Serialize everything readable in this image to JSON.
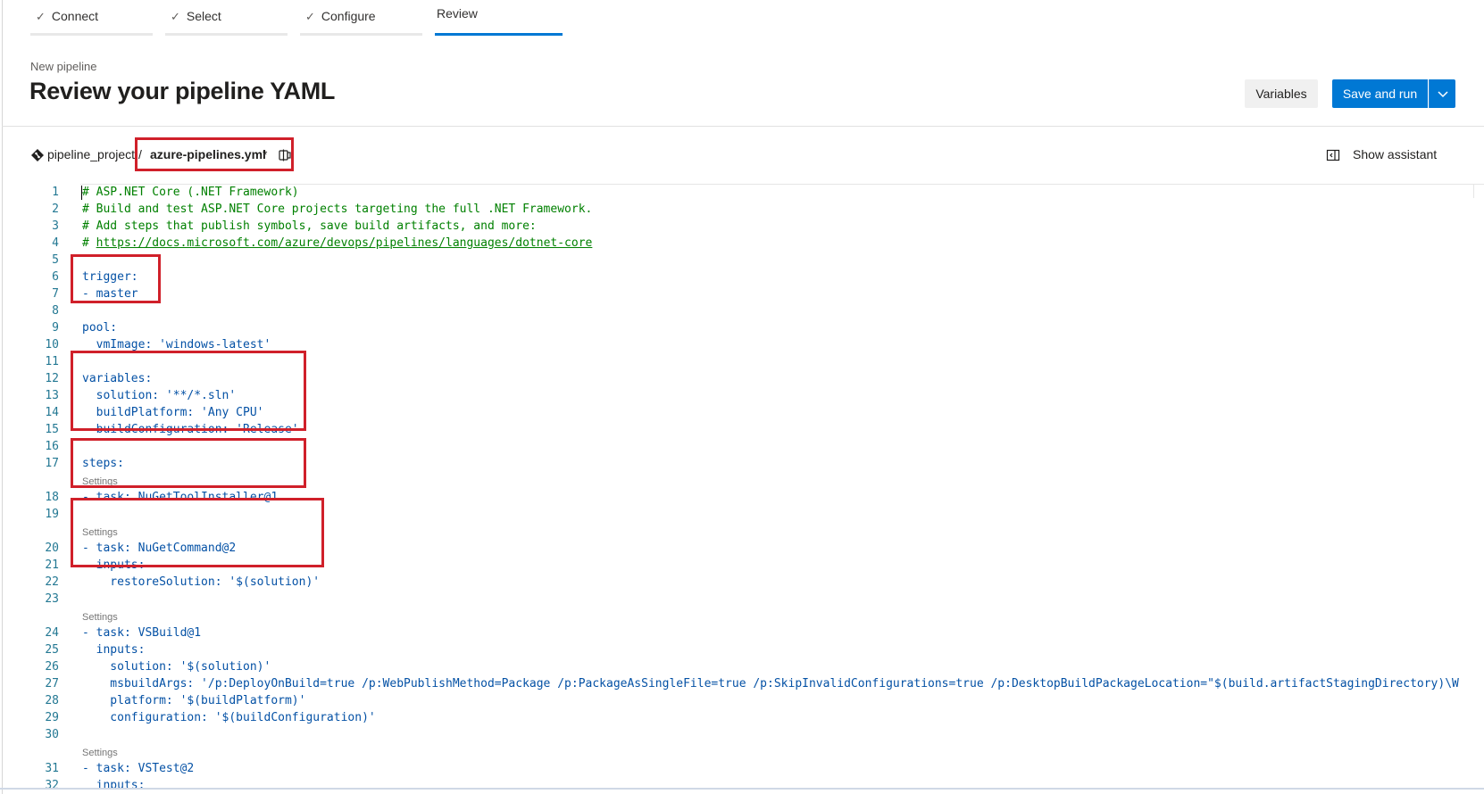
{
  "wizard": {
    "steps": [
      {
        "label": "Connect",
        "done": true
      },
      {
        "label": "Select",
        "done": true
      },
      {
        "label": "Configure",
        "done": true
      },
      {
        "label": "Review",
        "done": false,
        "active": true
      }
    ],
    "check_glyph": "✓"
  },
  "header": {
    "subtitle": "New pipeline",
    "title": "Review your pipeline YAML",
    "variables_button": "Variables",
    "save_run_button": "Save and run"
  },
  "breadcrumb": {
    "repo": "pipeline_project",
    "separator": "/",
    "file": "azure-pipelines.yml",
    "modified_marker": "*"
  },
  "assistant": {
    "label": "Show assistant"
  },
  "editor": {
    "lens_label": "Settings",
    "lines": [
      {
        "n": "1",
        "text": "# ASP.NET Core (.NET Framework)",
        "kind": "comment"
      },
      {
        "n": "2",
        "text": "# Build and test ASP.NET Core projects targeting the full .NET Framework.",
        "kind": "comment"
      },
      {
        "n": "3",
        "text": "# Add steps that publish symbols, save build artifacts, and more:",
        "kind": "comment"
      },
      {
        "n": "4",
        "text": "https://docs.microsoft.com/azure/devops/pipelines/languages/dotnet-core",
        "kind": "link"
      },
      {
        "n": "5",
        "text": "",
        "kind": "plain"
      },
      {
        "n": "6",
        "text": "trigger:",
        "kind": "plain"
      },
      {
        "n": "7",
        "text": "- master",
        "kind": "plain"
      },
      {
        "n": "8",
        "text": "",
        "kind": "plain"
      },
      {
        "n": "9",
        "text": "pool:",
        "kind": "plain"
      },
      {
        "n": "10",
        "text": "  vmImage: 'windows-latest'",
        "kind": "plain"
      },
      {
        "n": "11",
        "text": "",
        "kind": "plain"
      },
      {
        "n": "12",
        "text": "variables:",
        "kind": "plain"
      },
      {
        "n": "13",
        "text": "  solution: '**/*.sln'",
        "kind": "plain"
      },
      {
        "n": "14",
        "text": "  buildPlatform: 'Any CPU'",
        "kind": "plain"
      },
      {
        "n": "15",
        "text": "  buildConfiguration: 'Release'",
        "kind": "plain"
      },
      {
        "n": "16",
        "text": "",
        "kind": "plain"
      },
      {
        "n": "17",
        "text": "steps:",
        "kind": "plain"
      },
      {
        "n": "",
        "text": "Settings",
        "kind": "lens"
      },
      {
        "n": "18",
        "text": "- task: NuGetToolInstaller@1",
        "kind": "plain"
      },
      {
        "n": "19",
        "text": "",
        "kind": "plain"
      },
      {
        "n": "",
        "text": "Settings",
        "kind": "lens"
      },
      {
        "n": "20",
        "text": "- task: NuGetCommand@2",
        "kind": "plain"
      },
      {
        "n": "21",
        "text": "  inputs:",
        "kind": "plain"
      },
      {
        "n": "22",
        "text": "    restoreSolution: '$(solution)'",
        "kind": "plain"
      },
      {
        "n": "23",
        "text": "",
        "kind": "plain"
      },
      {
        "n": "",
        "text": "Settings",
        "kind": "lens"
      },
      {
        "n": "24",
        "text": "- task: VSBuild@1",
        "kind": "plain"
      },
      {
        "n": "25",
        "text": "  inputs:",
        "kind": "plain"
      },
      {
        "n": "26",
        "text": "    solution: '$(solution)'",
        "kind": "plain"
      },
      {
        "n": "27",
        "text": "    msbuildArgs: '/p:DeployOnBuild=true /p:WebPublishMethod=Package /p:PackageAsSingleFile=true /p:SkipInvalidConfigurations=true /p:DesktopBuildPackageLocation=\"$(build.artifactStagingDirectory)\\W",
        "kind": "plain"
      },
      {
        "n": "28",
        "text": "    platform: '$(buildPlatform)'",
        "kind": "plain"
      },
      {
        "n": "29",
        "text": "    configuration: '$(buildConfiguration)'",
        "kind": "plain"
      },
      {
        "n": "30",
        "text": "",
        "kind": "plain"
      },
      {
        "n": "",
        "text": "Settings",
        "kind": "lens"
      },
      {
        "n": "31",
        "text": "- task: VSTest@2",
        "kind": "plain"
      },
      {
        "n": "32",
        "text": "  inputs:",
        "kind": "plain"
      }
    ]
  },
  "colors": {
    "accent": "#0078d4",
    "annotation": "#d0202a",
    "comment": "#008000",
    "yaml": "#0451a5",
    "line_number": "#237893"
  }
}
